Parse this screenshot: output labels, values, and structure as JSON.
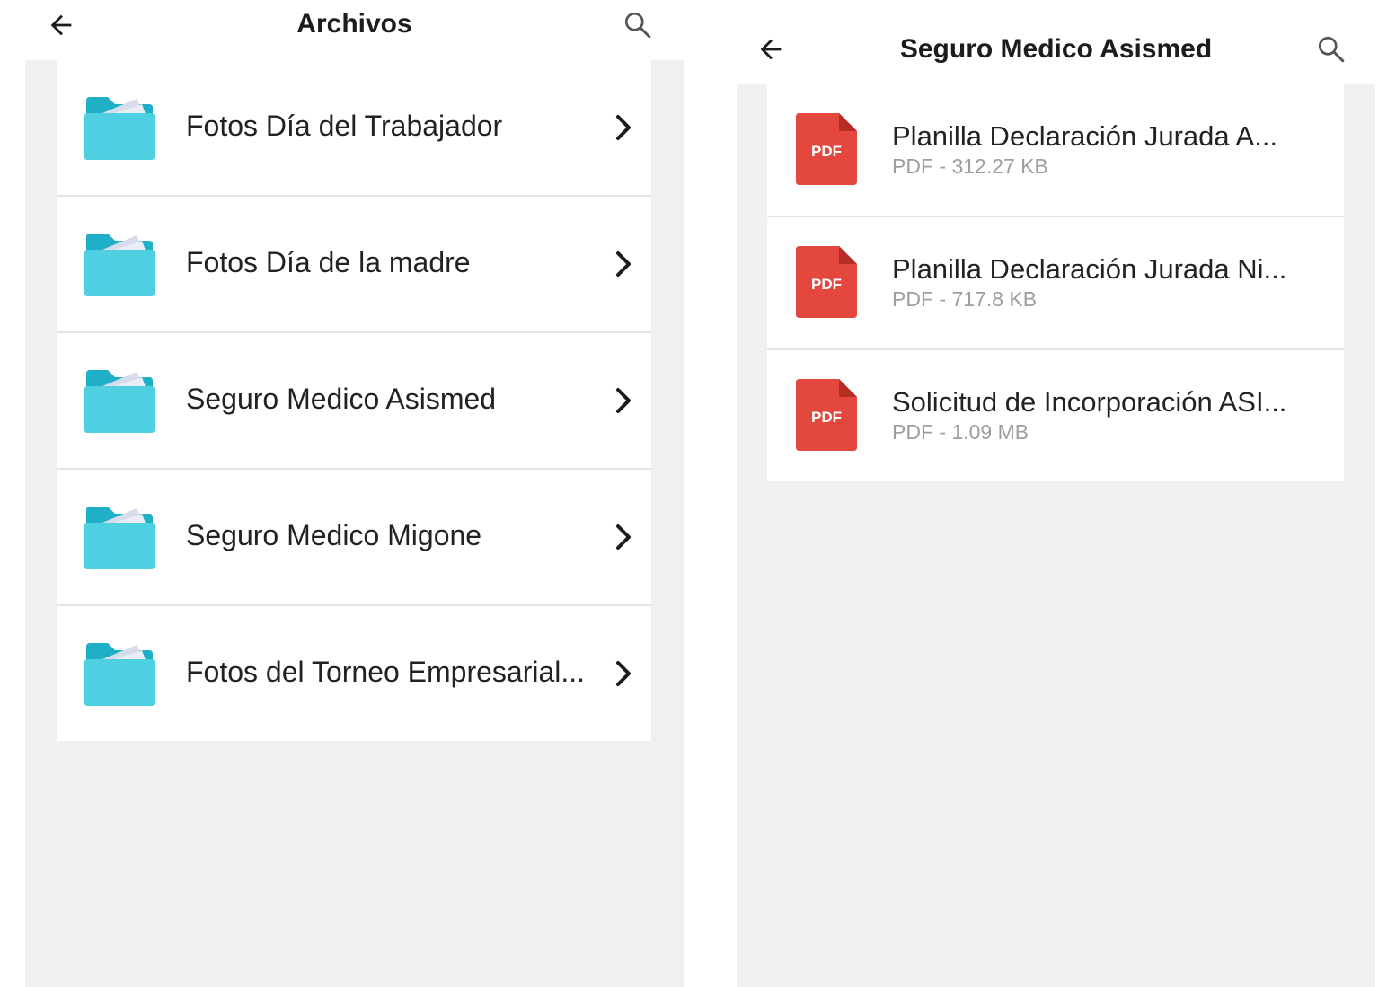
{
  "colors": {
    "folder": "#4fd0e2",
    "folder_dark": "#1fb0c7",
    "pdf": "#e3473d",
    "pdf_fold": "#b72e27",
    "background": "#f0f0f0",
    "text": "#222222",
    "meta_text": "#9e9e9e"
  },
  "left_screen": {
    "title": "Archivos",
    "back_icon": "arrow-left-icon",
    "search_icon": "search-icon",
    "folders": [
      {
        "label": "Fotos Día del Trabajador",
        "icon": "folder-icon"
      },
      {
        "label": "Fotos Día de la madre",
        "icon": "folder-icon"
      },
      {
        "label": "Seguro Medico Asismed",
        "icon": "folder-icon"
      },
      {
        "label": "Seguro Medico Migone",
        "icon": "folder-icon"
      },
      {
        "label": "Fotos del Torneo Empresarial...",
        "icon": "folder-icon"
      }
    ]
  },
  "right_screen": {
    "title": "Seguro Medico Asismed",
    "back_icon": "arrow-left-icon",
    "search_icon": "search-icon",
    "pdf_badge": "PDF",
    "files": [
      {
        "name": "Planilla Declaración Jurada A...",
        "meta": "PDF - 312.27 KB"
      },
      {
        "name": "Planilla Declaración Jurada Ni...",
        "meta": "PDF - 717.8 KB"
      },
      {
        "name": "Solicitud de Incorporación ASI...",
        "meta": "PDF - 1.09 MB"
      }
    ]
  }
}
